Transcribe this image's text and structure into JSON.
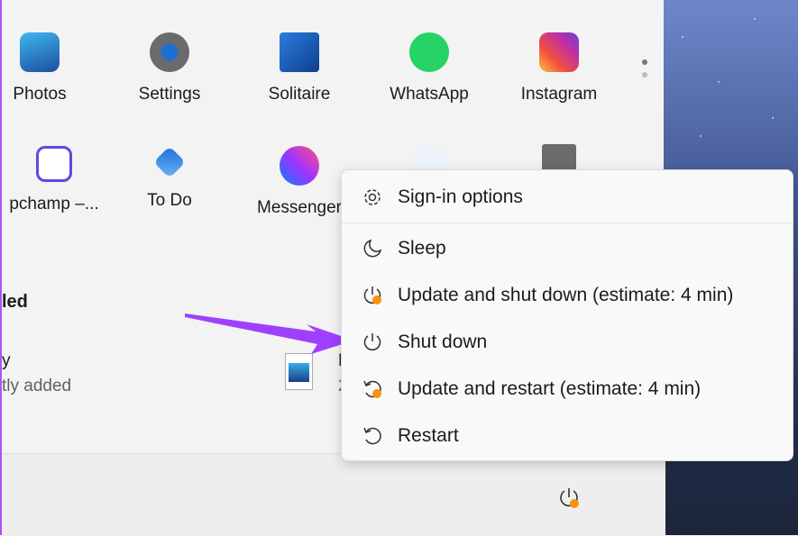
{
  "apps_row1": [
    {
      "label": "Photos",
      "icon": "photos-icon"
    },
    {
      "label": "Settings",
      "icon": "gear-icon"
    },
    {
      "label": "Solitaire",
      "icon": "cards-icon"
    },
    {
      "label": "WhatsApp",
      "icon": "whatsapp-icon"
    },
    {
      "label": "Instagram",
      "icon": "instagram-icon"
    }
  ],
  "apps_row2": [
    {
      "label": "pchamp –...",
      "icon": "clipchamp-icon"
    },
    {
      "label": "To Do",
      "icon": "todo-icon"
    },
    {
      "label": "Messenger",
      "icon": "messenger-icon"
    },
    {
      "label": "",
      "icon": "sudoku-icon"
    },
    {
      "label": "",
      "icon": "calculator-icon"
    }
  ],
  "recommended": {
    "heading": "led",
    "item1_title": "y",
    "item1_sub": "tly added",
    "item2_title": "H",
    "item2_sub": "2"
  },
  "power_menu": {
    "items": [
      {
        "label": "Sign-in options",
        "icon": "gear-icon"
      },
      {
        "label": "Sleep",
        "icon": "moon-icon"
      },
      {
        "label": "Update and shut down (estimate: 4 min)",
        "icon": "update-power-icon"
      },
      {
        "label": "Shut down",
        "icon": "power-icon"
      },
      {
        "label": "Update and restart (estimate: 4 min)",
        "icon": "update-restart-icon"
      },
      {
        "label": "Restart",
        "icon": "restart-icon"
      }
    ]
  },
  "colors": {
    "accent_badge": "#f7930e",
    "arrow": "#a040ff"
  }
}
